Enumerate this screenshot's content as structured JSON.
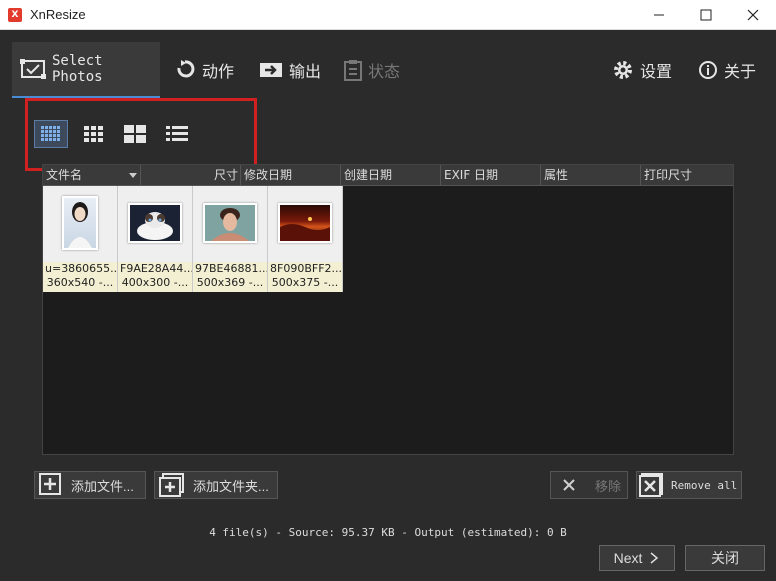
{
  "window": {
    "title": "XnResize",
    "icon_name": "xnresize-app-icon"
  },
  "tabs": [
    {
      "label": "Select Photos",
      "icon": "select-photos-icon",
      "state": "active"
    },
    {
      "label": "动作",
      "icon": "action-icon",
      "state": "normal"
    },
    {
      "label": "输出",
      "icon": "output-icon",
      "state": "normal"
    },
    {
      "label": "状态",
      "icon": "status-icon",
      "state": "disabled"
    }
  ],
  "top_right": {
    "settings_label": "设置",
    "about_label": "关于"
  },
  "view_modes": [
    {
      "name": "small-grid-view",
      "state": "active"
    },
    {
      "name": "medium-grid-view",
      "state": "normal"
    },
    {
      "name": "large-grid-view",
      "state": "normal"
    },
    {
      "name": "details-list-view",
      "state": "normal"
    }
  ],
  "columns": [
    "文件名",
    "尺寸",
    "修改日期",
    "创建日期",
    "EXIF 日期",
    "属性",
    "打印尺寸"
  ],
  "files": [
    {
      "name": "u=3860655...",
      "size": "360x540 -..."
    },
    {
      "name": "F9AE28A44...",
      "size": "400x300 -..."
    },
    {
      "name": "97BE46881...",
      "size": "500x369 -..."
    },
    {
      "name": "8F090BFF2...",
      "size": "500x375 -..."
    }
  ],
  "buttons": {
    "add_files": "添加文件...",
    "add_folder": "添加文件夹...",
    "remove": "移除",
    "remove_all": "Remove all",
    "next": "Next",
    "close": "关闭"
  },
  "status_text": "4 file(s) - Source: 95.37 KB - Output (estimated): 0 B",
  "colors": {
    "accent": "#4a8bd6",
    "annotation_box": "#d02020",
    "background": "#2b2b2b"
  }
}
